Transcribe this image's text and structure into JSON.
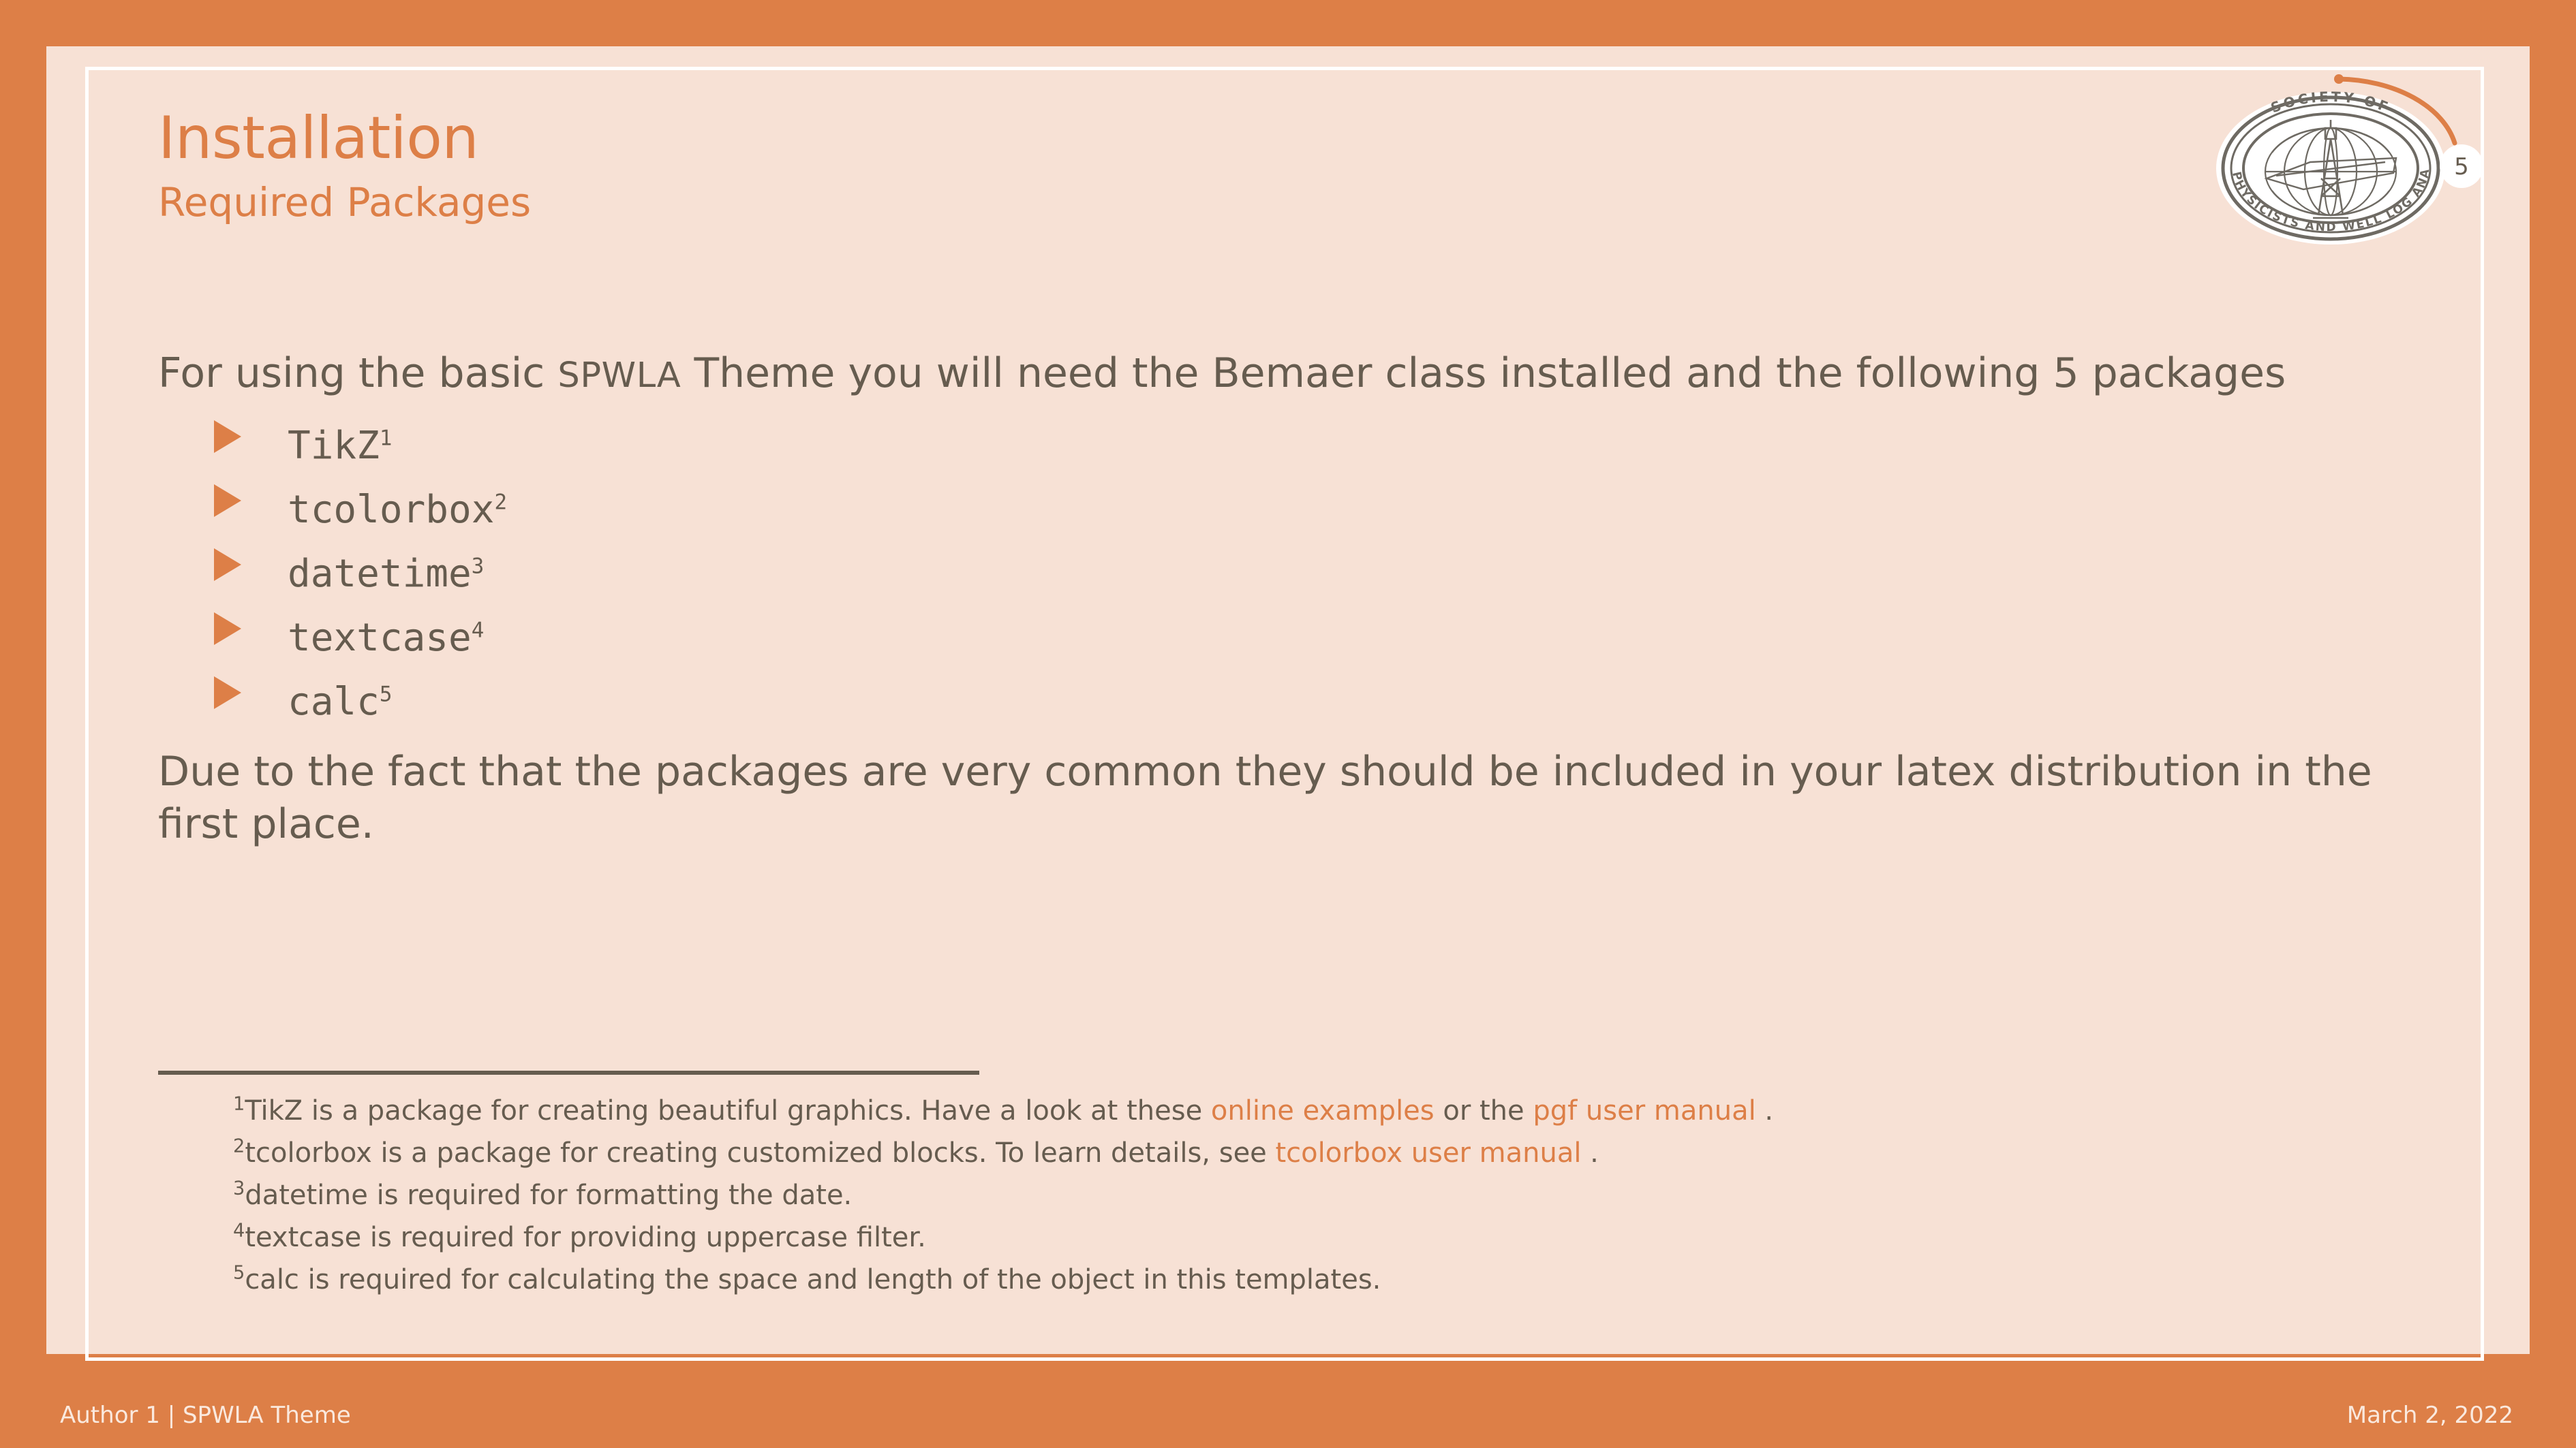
{
  "colors": {
    "accent_orange": "#DD7F47",
    "slide_background": "#F7E1D5",
    "body_text": "#665C4F",
    "frame_white": "#FFFFFF",
    "footer_text": "#FAE9DE",
    "logo_gray": "#6E6A63"
  },
  "header": {
    "title": "Installation",
    "subtitle": "Required Packages"
  },
  "logo": {
    "top_arc_text": "SOCIETY OF",
    "bottom_arc_text": "PETROPHYSICISTS AND WELL LOG ANALYSTS",
    "page_number": "5"
  },
  "content": {
    "intro_pre": "For using the basic ",
    "intro_smallcaps": "SPWLA",
    "intro_post": " Theme you will need the Bemaer class installed and the following 5 packages",
    "packages": [
      {
        "name": "TikZ",
        "footnote_marker": "1"
      },
      {
        "name": "tcolorbox",
        "footnote_marker": "2"
      },
      {
        "name": "datetime",
        "footnote_marker": "3"
      },
      {
        "name": "textcase",
        "footnote_marker": "4"
      },
      {
        "name": "calc",
        "footnote_marker": "5"
      }
    ],
    "closing_paragraph": "Due to the fact that the packages are very common they should be included in your latex distribution in the first place."
  },
  "footnotes": [
    {
      "marker": "1",
      "text_before": "TikZ is a package for creating beautiful graphics. Have a look at these ",
      "link1": "online examples",
      "text_middle": " or the ",
      "link2": "pgf user manual",
      "text_after": " ."
    },
    {
      "marker": "2",
      "text_before": "tcolorbox is a package for creating customized blocks. To learn details, see ",
      "link1": "tcolorbox user manual",
      "text_middle": "",
      "link2": "",
      "text_after": " ."
    },
    {
      "marker": "3",
      "text_before": "datetime is required for formatting the date.",
      "link1": "",
      "text_middle": "",
      "link2": "",
      "text_after": ""
    },
    {
      "marker": "4",
      "text_before": "textcase is required for providing uppercase filter.",
      "link1": "",
      "text_middle": "",
      "link2": "",
      "text_after": ""
    },
    {
      "marker": "5",
      "text_before": "calc is required for calculating the space and length of the object in this templates.",
      "link1": "",
      "text_middle": "",
      "link2": "",
      "text_after": ""
    }
  ],
  "footer": {
    "left": "Author 1 | SPWLA Theme",
    "right": "March 2, 2022"
  }
}
